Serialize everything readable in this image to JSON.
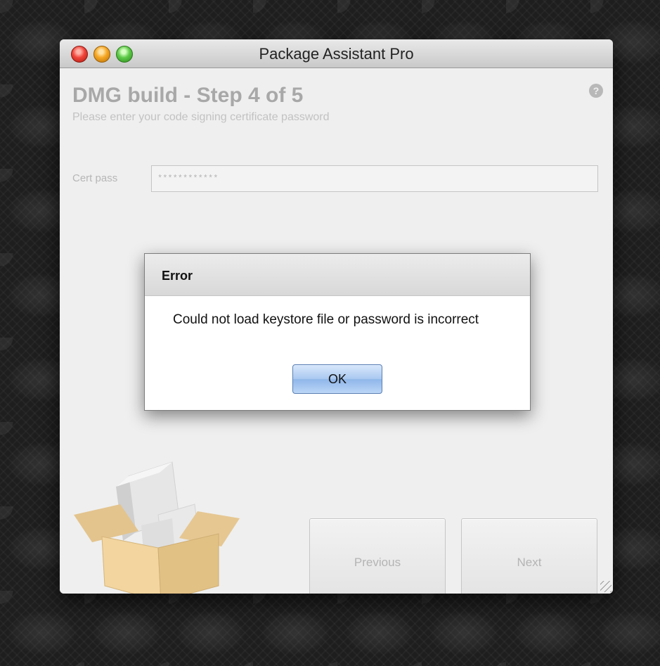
{
  "window": {
    "title": "Package Assistant Pro"
  },
  "wizard": {
    "step_title": "DMG build - Step 4 of 5",
    "step_subtitle": "Please enter your code signing certificate password",
    "help_glyph": "?"
  },
  "form": {
    "cert_pass_label": "Cert pass",
    "cert_pass_value": "************"
  },
  "nav": {
    "previous_label": "Previous",
    "next_label": "Next"
  },
  "dialog": {
    "title": "Error",
    "message": "Could not load keystore file or password is incorrect",
    "ok_label": "OK"
  },
  "icons": {
    "close": "close-icon",
    "minimize": "minimize-icon",
    "zoom": "zoom-icon",
    "help": "help-icon",
    "package": "package-box-icon",
    "resize": "resize-grip-icon"
  },
  "colors": {
    "close": "#f0443a",
    "minimize": "#f5a623",
    "zoom": "#5ec948",
    "ok_button": "#a9c8f0"
  }
}
